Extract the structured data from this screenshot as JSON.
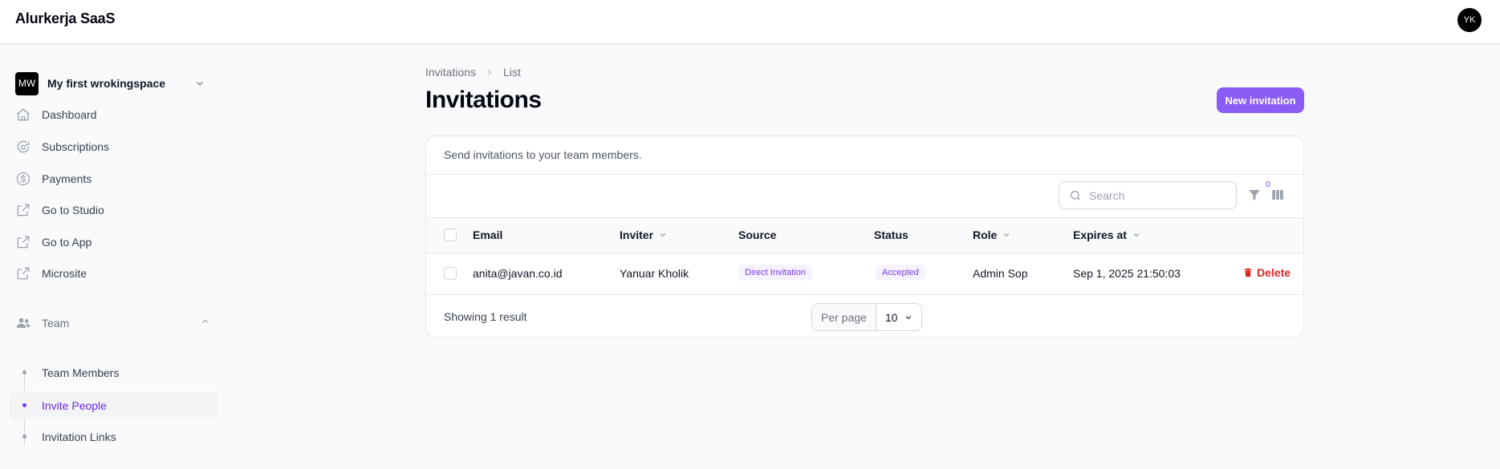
{
  "app": {
    "brand": "Alurkerja SaaS",
    "user_initials": "YK"
  },
  "workspace": {
    "initials": "MW",
    "name": "My first wrokingspace"
  },
  "sidebar": {
    "items": [
      {
        "label": "Dashboard",
        "icon": "home-icon"
      },
      {
        "label": "Subscriptions",
        "icon": "subscriptions-icon"
      },
      {
        "label": "Payments",
        "icon": "dollar-icon"
      },
      {
        "label": "Go to Studio",
        "icon": "external-link-icon"
      },
      {
        "label": "Go to App",
        "icon": "external-link-icon"
      },
      {
        "label": "Microsite",
        "icon": "external-link-icon"
      }
    ],
    "team_group": {
      "label": "Team",
      "icon": "users-icon",
      "children": [
        {
          "label": "Team Members",
          "active": false
        },
        {
          "label": "Invite People",
          "active": true
        },
        {
          "label": "Invitation Links",
          "active": false
        }
      ]
    }
  },
  "breadcrumb": {
    "parent": "Invitations",
    "current": "List"
  },
  "page": {
    "title": "Invitations",
    "new_button_label": "New invitation"
  },
  "card": {
    "description": "Send invitations to your team members."
  },
  "toolbar": {
    "search_placeholder": "Search",
    "filter_count": "0"
  },
  "table": {
    "columns": [
      "Email",
      "Inviter",
      "Source",
      "Status",
      "Role",
      "Expires at"
    ],
    "rows": [
      {
        "email": "anita@javan.co.id",
        "inviter": "Yanuar Kholik",
        "source": "Direct Invitation",
        "status": "Accepted",
        "role": "Admin Sop",
        "expires_at": "Sep 1, 2025 21:50:03",
        "delete_label": "Delete"
      }
    ]
  },
  "footer": {
    "showing": "Showing 1 result",
    "per_page_label": "Per page",
    "per_page_value": "10"
  },
  "colors": {
    "accent": "#8b5cf6",
    "danger": "#dc2626",
    "active_text": "#6d28d9"
  }
}
